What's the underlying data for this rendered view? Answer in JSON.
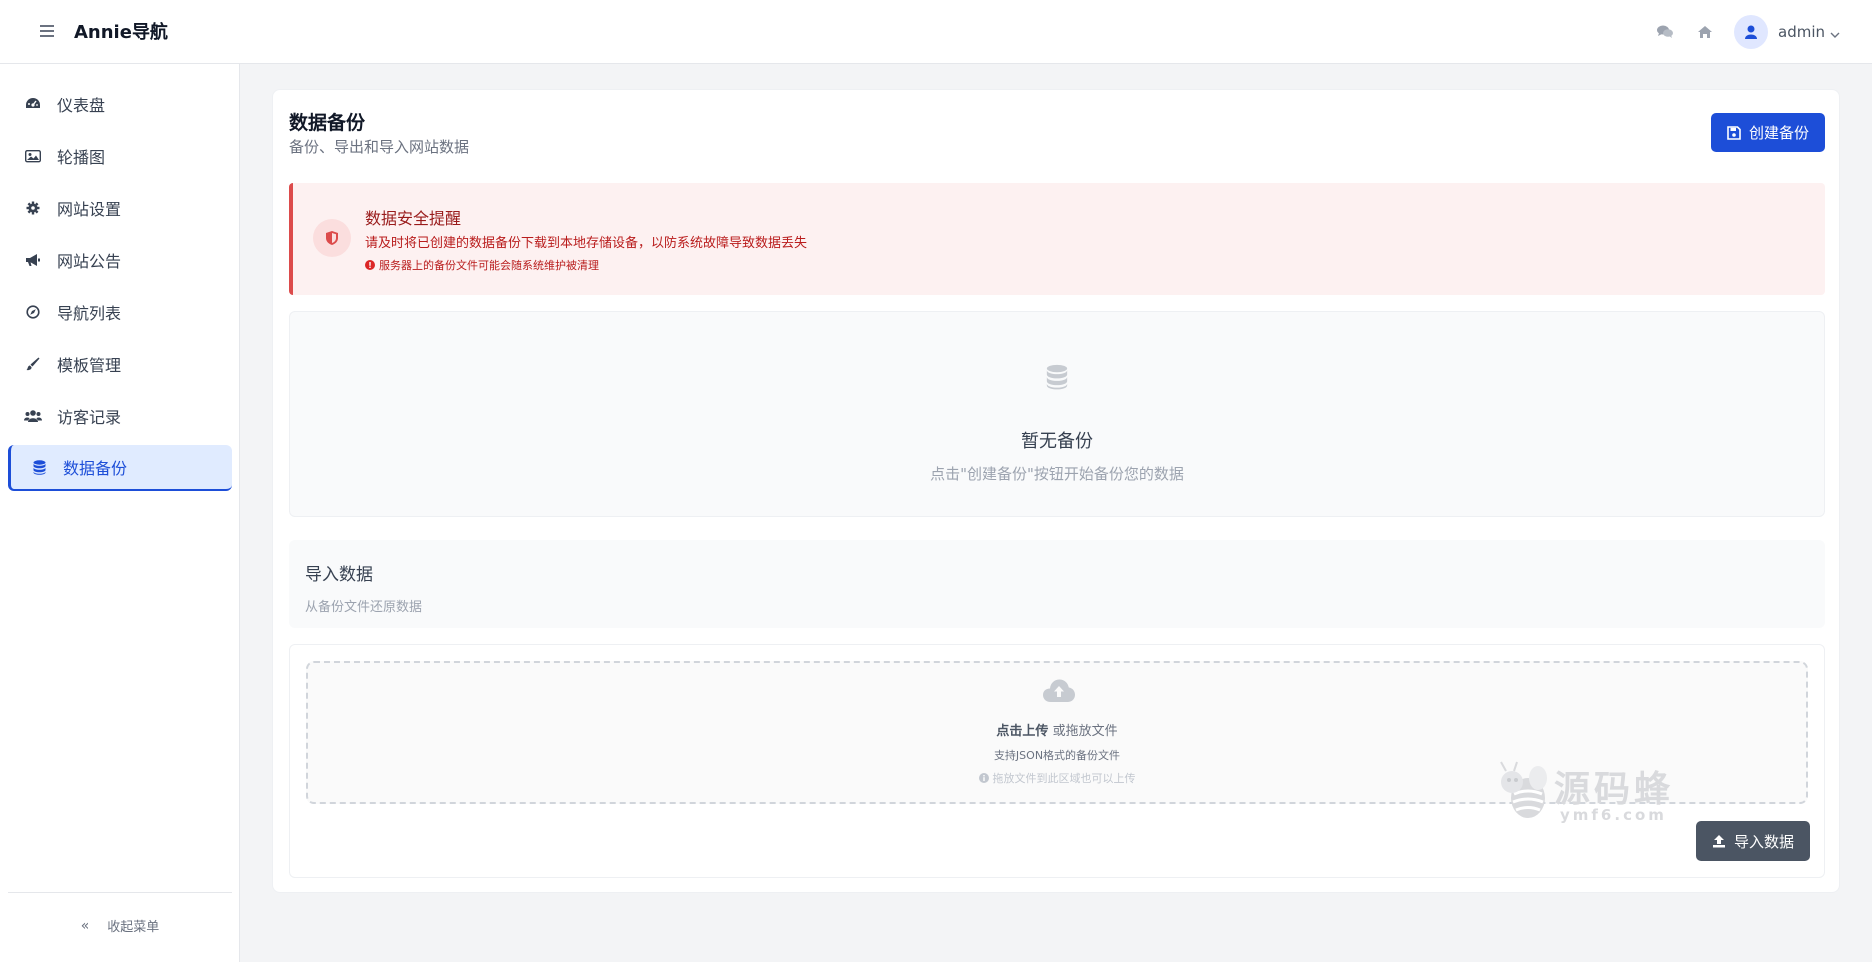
{
  "app": {
    "brand": "Annie导航"
  },
  "header": {
    "user_name": "admin"
  },
  "sidebar": {
    "items": [
      {
        "label": "仪表盘",
        "icon": "dashboard-icon"
      },
      {
        "label": "轮播图",
        "icon": "image-icon"
      },
      {
        "label": "网站设置",
        "icon": "gear-icon"
      },
      {
        "label": "网站公告",
        "icon": "megaphone-icon"
      },
      {
        "label": "导航列表",
        "icon": "compass-icon"
      },
      {
        "label": "模板管理",
        "icon": "brush-icon"
      },
      {
        "label": "访客记录",
        "icon": "users-icon"
      },
      {
        "label": "数据备份",
        "icon": "database-icon",
        "active": true
      }
    ],
    "collapse_label": "收起菜单"
  },
  "page": {
    "title": "数据备份",
    "subtitle": "备份、导出和导入网站数据",
    "create_button": "创建备份"
  },
  "alert": {
    "title": "数据安全提醒",
    "text": "请及时将已创建的数据备份下载到本地存储设备，以防系统故障导致数据丢失",
    "note": "服务器上的备份文件可能会随系统维护被清理"
  },
  "empty": {
    "title": "暂无备份",
    "subtitle": "点击\"创建备份\"按钮开始备份您的数据"
  },
  "import": {
    "title": "导入数据",
    "subtitle": "从备份文件还原数据",
    "upload_bold": "点击上传",
    "upload_rest": " 或拖放文件",
    "format_hint": "支持JSON格式的备份文件",
    "drop_hint": "拖放文件到此区域也可以上传",
    "button": "导入数据"
  },
  "watermark": {
    "text": "源码蜂",
    "sub": "ymf6.com"
  },
  "colors": {
    "primary": "#1d4ed8",
    "danger": "#dc4b4b",
    "dark_button": "#4b5563"
  }
}
